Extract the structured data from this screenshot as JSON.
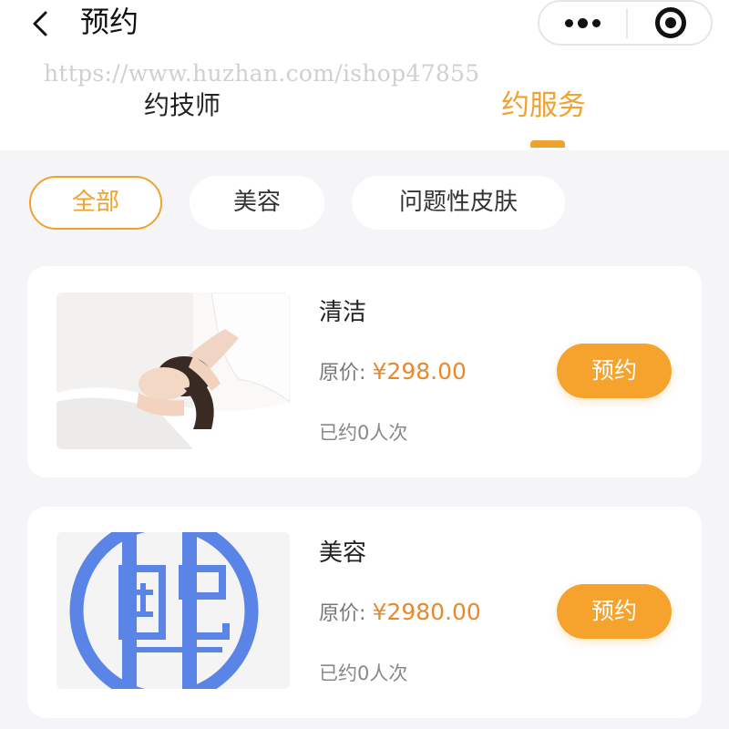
{
  "header": {
    "title": "预约",
    "back_icon": "chevron-left-icon",
    "more_icon": "more-dots-icon",
    "close_icon": "target-close-icon"
  },
  "watermark": "https://www.huzhan.com/ishop47855",
  "tabs": [
    {
      "label": "约技师",
      "active": false
    },
    {
      "label": "约服务",
      "active": true
    }
  ],
  "filters": [
    {
      "label": "全部",
      "active": true
    },
    {
      "label": "美容",
      "active": false
    },
    {
      "label": "问题性皮肤",
      "active": false
    }
  ],
  "services": [
    {
      "name": "清洁",
      "price_label": "原价:",
      "price": "¥298.00",
      "booked": "已约0人次",
      "button": "预约",
      "image": "facial-massage-photo"
    },
    {
      "name": "美容",
      "price_label": "原价:",
      "price": "¥2980.00",
      "booked": "已约0人次",
      "button": "预约",
      "image": "blue-seal-logo"
    }
  ],
  "colors": {
    "accent": "#f0a22e",
    "button": "#f5a32c",
    "price": "#e8892c",
    "background": "#f5f5f7"
  }
}
